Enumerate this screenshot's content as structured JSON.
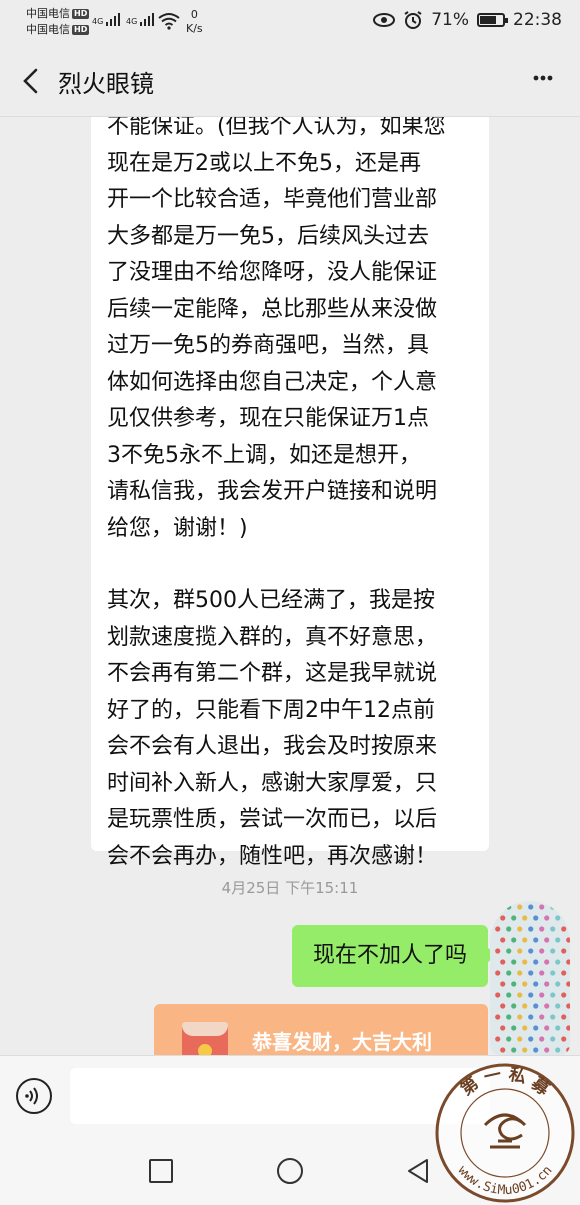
{
  "status_bar": {
    "carrier1": "中国电信",
    "carrier2": "中国电信",
    "hd_badge": "HD",
    "signal1": "4G",
    "signal2": "4G",
    "net_speed_value": "0",
    "net_speed_unit": "K/s",
    "battery_percent": "71%",
    "battery_level": 0.71,
    "time": "22:38"
  },
  "header": {
    "title": "烈火眼镜",
    "more": "⋮"
  },
  "messages": {
    "incoming_para1": "不能保证。(但我个人认为，如果您\n现在是万2或以上不免5，还是再\n开一个比较合适，毕竟他们营业部\n大多都是万一免5，后续风头过去\n了没理由不给您降呀，没人能保证\n后续一定能降，总比那些从来没做\n过万一免5的券商强吧，当然，具\n体如何选择由您自己决定，个人意\n见仅供参考，现在只能保证万1点\n3不免5永不上调，如还是想开，\n请私信我，我会发开户链接和说明\n给您，谢谢！)",
    "incoming_para2": "其次，群500人已经满了，我是按\n划款速度揽入群的，真不好意思，\n不会再有第二个群，这是我早就说\n好了的，只能看下周2中午12点前\n会不会有人退出，我会及时按原来\n时间补入新人，感谢大家厚爱，只\n是玩票性质，尝试一次而已，以后\n会不会再办，随性吧，再次感谢！",
    "timestamp": "4月25日 下午15:11",
    "outgoing": "现在不加人了吗",
    "red_packet": "恭喜发财，大吉大利"
  },
  "input": {
    "value": ""
  },
  "watermark": {
    "text": "www.SiMu001.cn",
    "seal_chars": [
      "第",
      "一",
      "私",
      "募"
    ]
  },
  "colors": {
    "background": "#ededed",
    "bubble_in": "#ffffff",
    "bubble_out": "#95ec69",
    "red_packet": "#f9b684",
    "timestamp": "#999999"
  }
}
